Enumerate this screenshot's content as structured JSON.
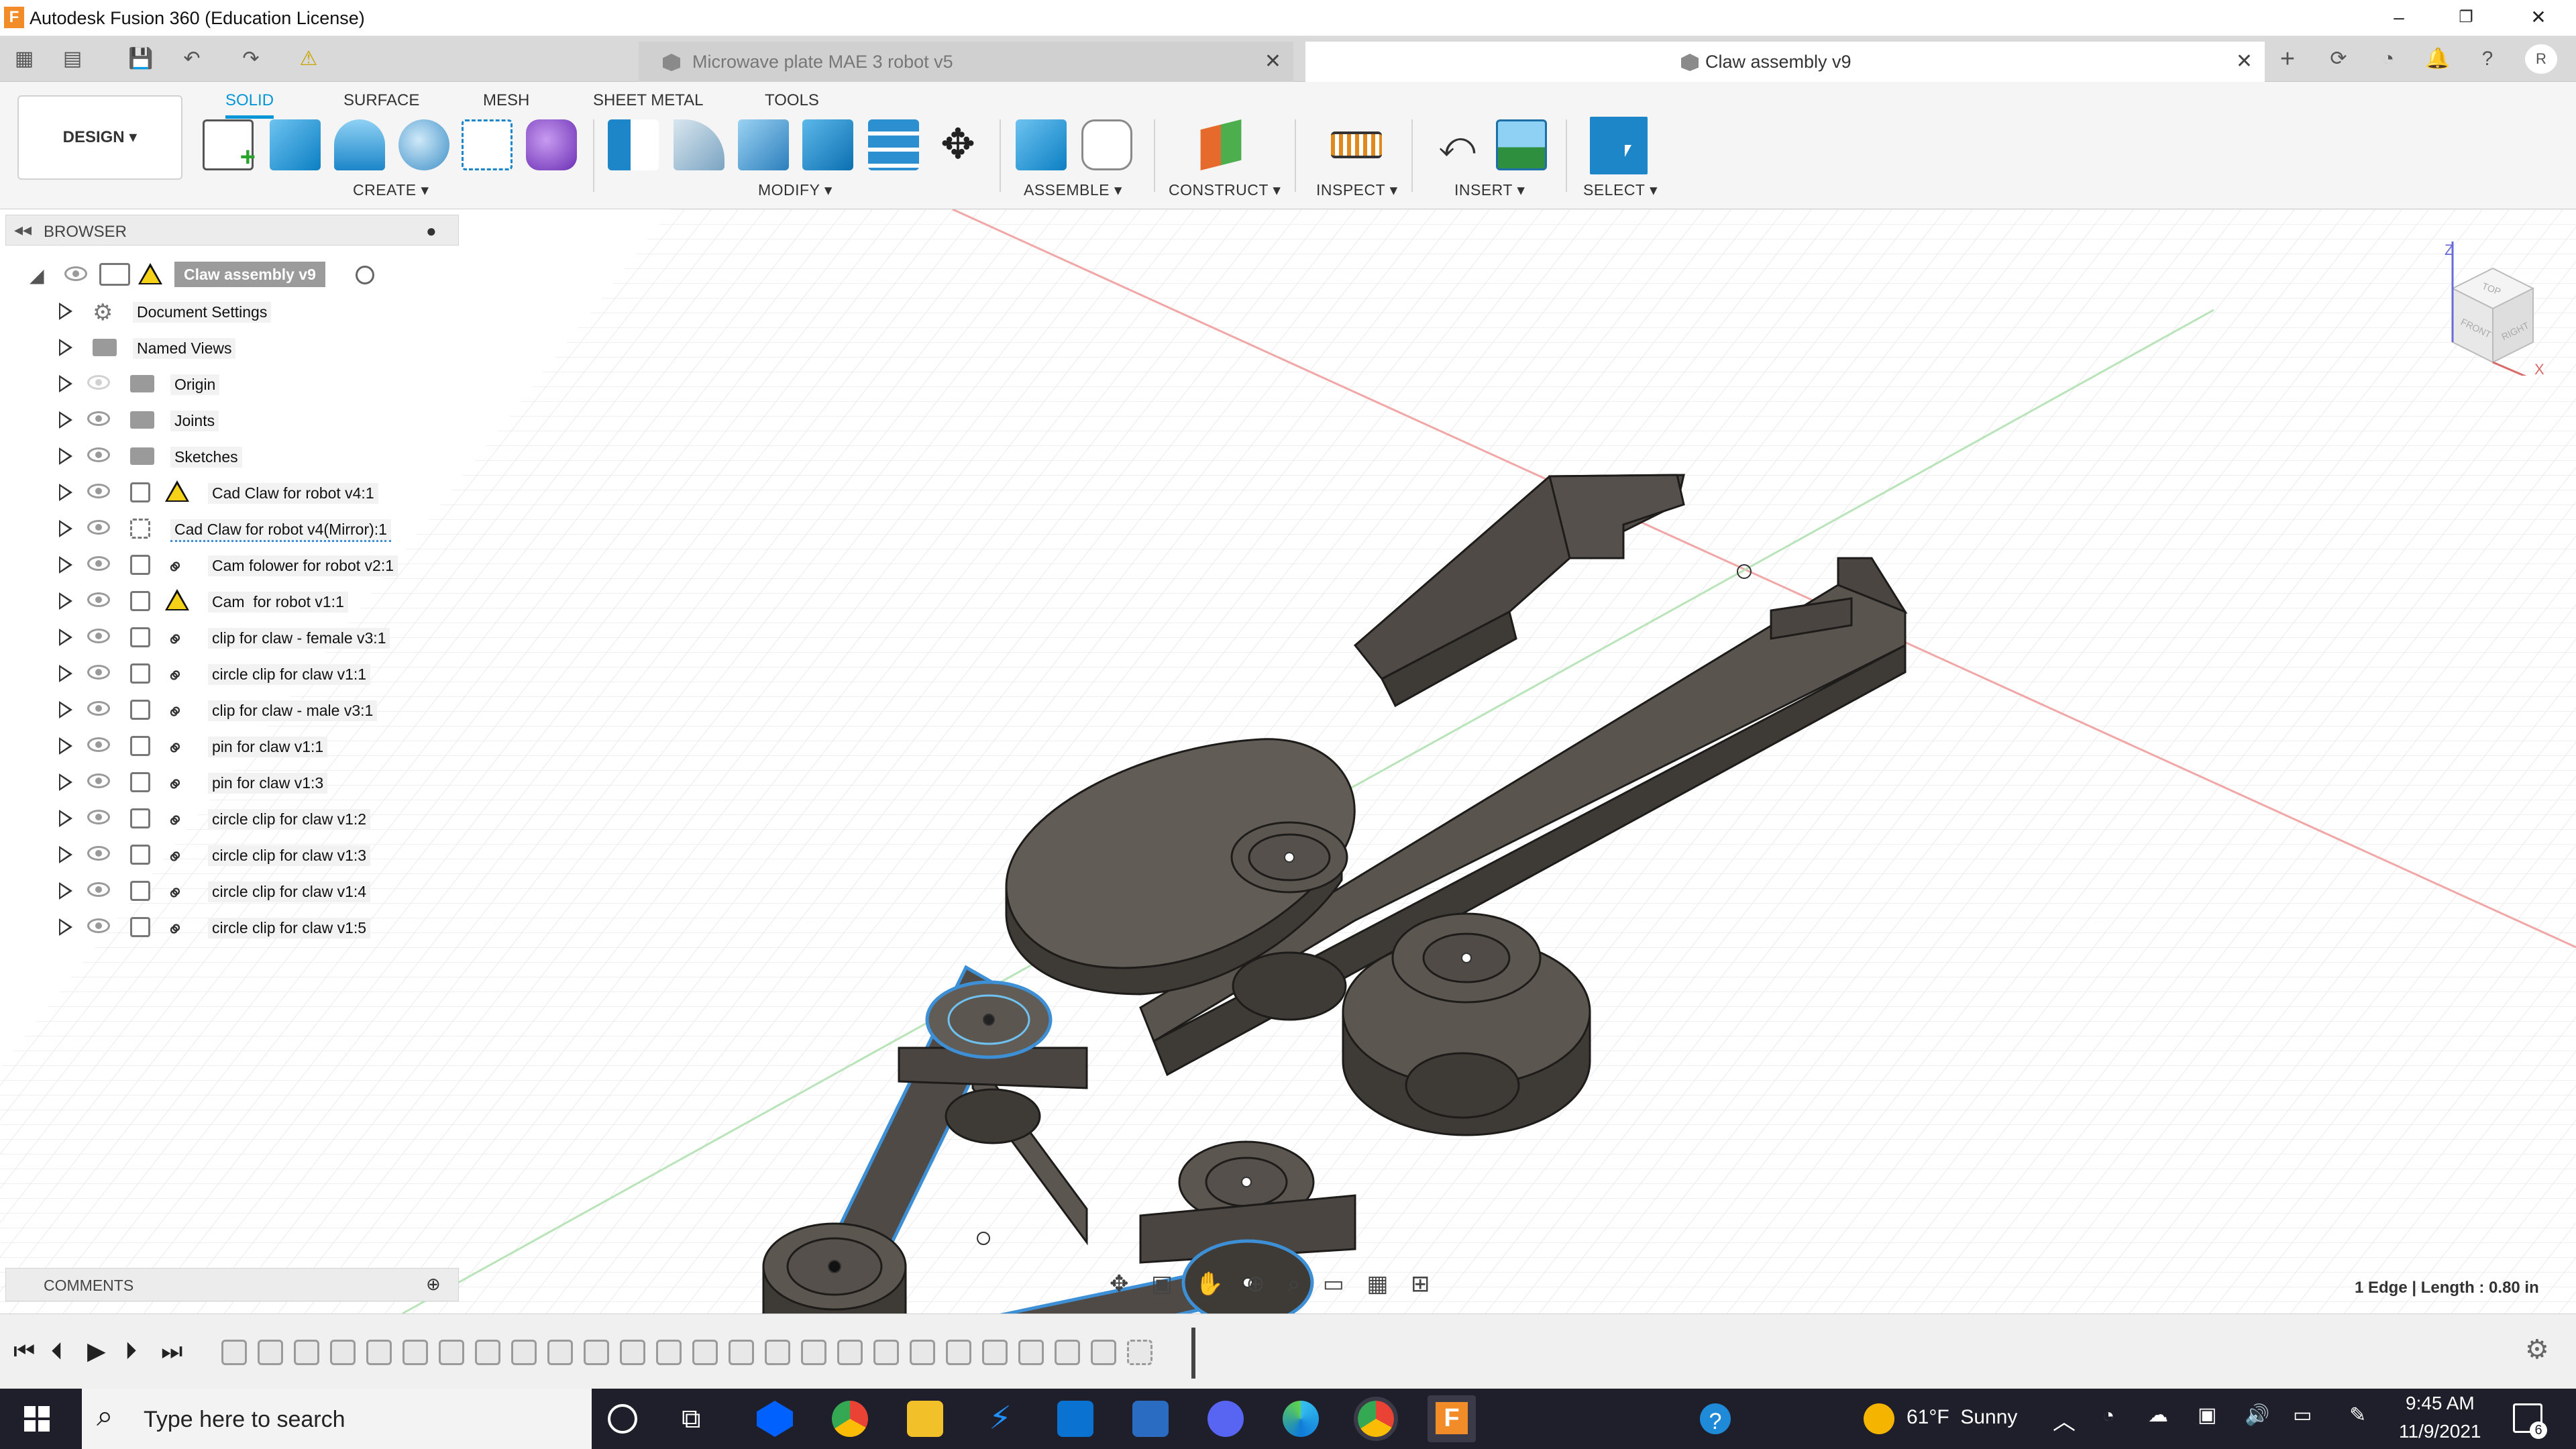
{
  "window": {
    "title": "Autodesk Fusion 360 (Education License)",
    "controls": [
      "minimize-icon",
      "restore-icon",
      "close-icon"
    ]
  },
  "tabs": [
    {
      "label": "Microwave plate MAE 3 robot v5",
      "active": false
    },
    {
      "label": "Claw assembly v9",
      "active": true
    }
  ],
  "ribbon": {
    "workspace": "DESIGN",
    "tabs": [
      "SOLID",
      "SURFACE",
      "MESH",
      "SHEET METAL",
      "TOOLS"
    ],
    "active_tab": "SOLID",
    "groups": [
      "CREATE",
      "MODIFY",
      "ASSEMBLE",
      "CONSTRUCT",
      "INSPECT",
      "INSERT",
      "SELECT"
    ],
    "accent": "#0696d7"
  },
  "browser": {
    "header": "BROWSER",
    "root": "Claw assembly v9",
    "items": [
      {
        "label": "Document Settings",
        "icon": "gear-icon"
      },
      {
        "label": "Named Views",
        "icon": "folder-icon"
      },
      {
        "label": "Origin",
        "icon": "folder-icon"
      },
      {
        "label": "Joints",
        "icon": "folder-icon"
      },
      {
        "label": "Sketches",
        "icon": "folder-icon"
      },
      {
        "label": "Cad Claw for robot v4:1",
        "icon": "warning-icon"
      },
      {
        "label": "Cad Claw for robot v4(Mirror):1",
        "icon": "none"
      },
      {
        "label": "Cam folower for robot v2:1",
        "icon": "link-icon"
      },
      {
        "label": "Cam  for robot v1:1",
        "icon": "warning-icon"
      },
      {
        "label": "clip for claw - female v3:1",
        "icon": "link-icon"
      },
      {
        "label": "circle clip for claw v1:1",
        "icon": "link-icon"
      },
      {
        "label": "clip for claw - male v3:1",
        "icon": "link-icon"
      },
      {
        "label": "pin for claw v1:1",
        "icon": "link-icon"
      },
      {
        "label": "pin for claw v1:3",
        "icon": "link-icon"
      },
      {
        "label": "circle clip for claw v1:2",
        "icon": "link-icon"
      },
      {
        "label": "circle clip for claw v1:3",
        "icon": "link-icon"
      },
      {
        "label": "circle clip for claw v1:4",
        "icon": "link-icon"
      },
      {
        "label": "circle clip for claw v1:5",
        "icon": "link-icon"
      }
    ]
  },
  "comments": {
    "header": "COMMENTS"
  },
  "viewcube": {
    "faces": [
      "TOP",
      "FRONT",
      "RIGHT"
    ],
    "axes": [
      "Z",
      "X"
    ]
  },
  "status": {
    "selection": "1 Edge | Length : 0.80 in"
  },
  "taskbar": {
    "search_placeholder": "Type here to search",
    "weather": "61°F  Sunny",
    "time": "9:45 AM",
    "date": "11/9/2021",
    "notifications": "6"
  }
}
